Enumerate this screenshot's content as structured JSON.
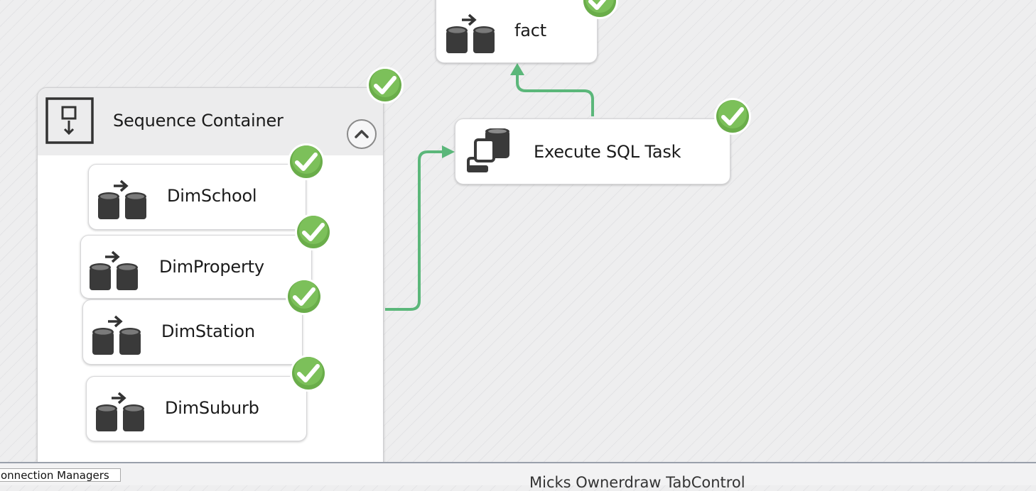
{
  "canvas": {
    "tasks": {
      "fact": {
        "label": "fact",
        "icon": "data-flow-task-icon",
        "status": "success-check-icon"
      },
      "execute_sql": {
        "label": "Execute SQL Task",
        "icon": "execute-sql-task-icon",
        "status": "success-check-icon"
      }
    },
    "sequence_container": {
      "label": "Sequence Container",
      "icon": "sequence-container-icon",
      "collapse_icon": "chevron-up-icon",
      "status": "success-check-icon",
      "items": [
        {
          "label": "DimSchool",
          "icon": "data-flow-task-icon"
        },
        {
          "label": "DimProperty",
          "icon": "data-flow-task-icon"
        },
        {
          "label": "DimStation",
          "icon": "data-flow-task-icon"
        },
        {
          "label": "DimSuburb",
          "icon": "data-flow-task-icon"
        }
      ]
    },
    "connector_color": "#5bb77a",
    "check_color": "#6ab04c"
  },
  "bottom_bar": {
    "tab_label": "onnection Managers",
    "owner_draw_text": "Micks Ownerdraw TabControl"
  }
}
